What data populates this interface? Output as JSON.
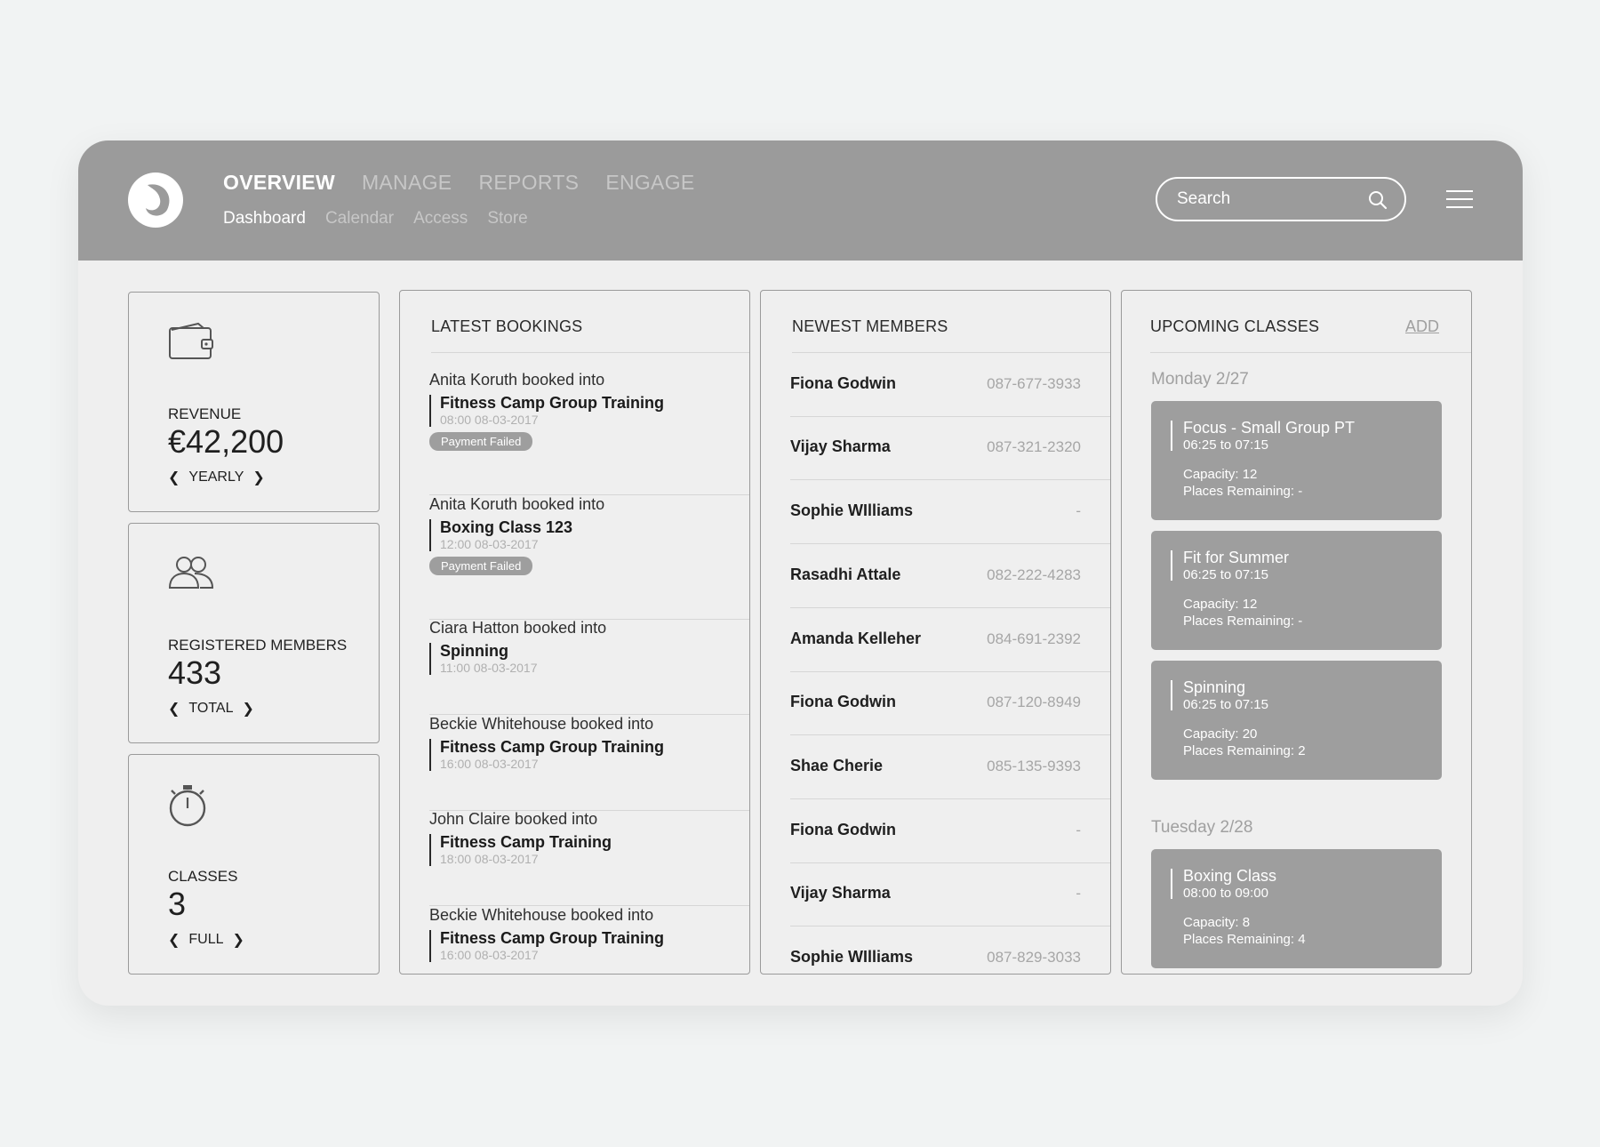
{
  "nav": {
    "main": [
      "OVERVIEW",
      "MANAGE",
      "REPORTS",
      "ENGAGE"
    ],
    "sub": [
      "Dashboard",
      "Calendar",
      "Access",
      "Store"
    ],
    "search_placeholder": "Search"
  },
  "stats": {
    "revenue": {
      "label": "REVENUE",
      "value": "€42,200",
      "period": "YEARLY",
      "icon": "wallet-icon"
    },
    "members": {
      "label": "REGISTERED MEMBERS",
      "value": "433",
      "period": "TOTAL",
      "icon": "users-icon"
    },
    "classes": {
      "label": "CLASSES",
      "value": "3",
      "period": "FULL",
      "icon": "stopwatch-icon"
    }
  },
  "bookings": {
    "title": "LATEST BOOKINGS",
    "items": [
      {
        "who": "Anita Koruth booked into",
        "class": "Fitness Camp Group Training",
        "time": "08:00 08-03-2017",
        "badge": "Payment Failed"
      },
      {
        "who": "Anita Koruth booked into",
        "class": "Boxing Class 123",
        "time": "12:00 08-03-2017",
        "badge": "Payment Failed"
      },
      {
        "who": "Ciara Hatton booked into",
        "class": "Spinning",
        "time": "11:00 08-03-2017",
        "badge": ""
      },
      {
        "who": "Beckie Whitehouse booked into",
        "class": "Fitness Camp Group Training",
        "time": "16:00 08-03-2017",
        "badge": ""
      },
      {
        "who": "John Claire booked into",
        "class": "Fitness Camp Training",
        "time": "18:00 08-03-2017",
        "badge": ""
      },
      {
        "who": "Beckie Whitehouse booked into",
        "class": "Fitness Camp Group Training",
        "time": "16:00 08-03-2017",
        "badge": ""
      }
    ]
  },
  "members": {
    "title": "NEWEST MEMBERS",
    "items": [
      {
        "name": "Fiona Godwin",
        "phone": "087-677-3933"
      },
      {
        "name": "Vijay Sharma",
        "phone": "087-321-2320"
      },
      {
        "name": "Sophie WIlliams",
        "phone": "-"
      },
      {
        "name": "Rasadhi Attale",
        "phone": "082-222-4283"
      },
      {
        "name": "Amanda Kelleher",
        "phone": "084-691-2392"
      },
      {
        "name": "Fiona Godwin",
        "phone": "087-120-8949"
      },
      {
        "name": "Shae Cherie",
        "phone": "085-135-9393"
      },
      {
        "name": "Fiona Godwin",
        "phone": "-"
      },
      {
        "name": "Vijay Sharma",
        "phone": "-"
      },
      {
        "name": "Sophie WIlliams",
        "phone": "087-829-3033"
      }
    ]
  },
  "classes": {
    "title": "UPCOMING CLASSES",
    "add_label": "ADD",
    "days": [
      {
        "label": "Monday 2/27",
        "items": [
          {
            "name": "Focus - Small Group PT",
            "time": "06:25 to 07:15",
            "capacity": "Capacity: 12",
            "remaining": "Places Remaining: -"
          },
          {
            "name": "Fit for Summer",
            "time": "06:25 to 07:15",
            "capacity": "Capacity: 12",
            "remaining": "Places Remaining: -"
          },
          {
            "name": "Spinning",
            "time": "06:25 to 07:15",
            "capacity": "Capacity: 20",
            "remaining": "Places Remaining: 2"
          }
        ]
      },
      {
        "label": "Tuesday 2/28",
        "items": [
          {
            "name": "Boxing Class",
            "time": "08:00 to 09:00",
            "capacity": "Capacity: 8",
            "remaining": "Places Remaining: 4"
          }
        ]
      }
    ]
  }
}
